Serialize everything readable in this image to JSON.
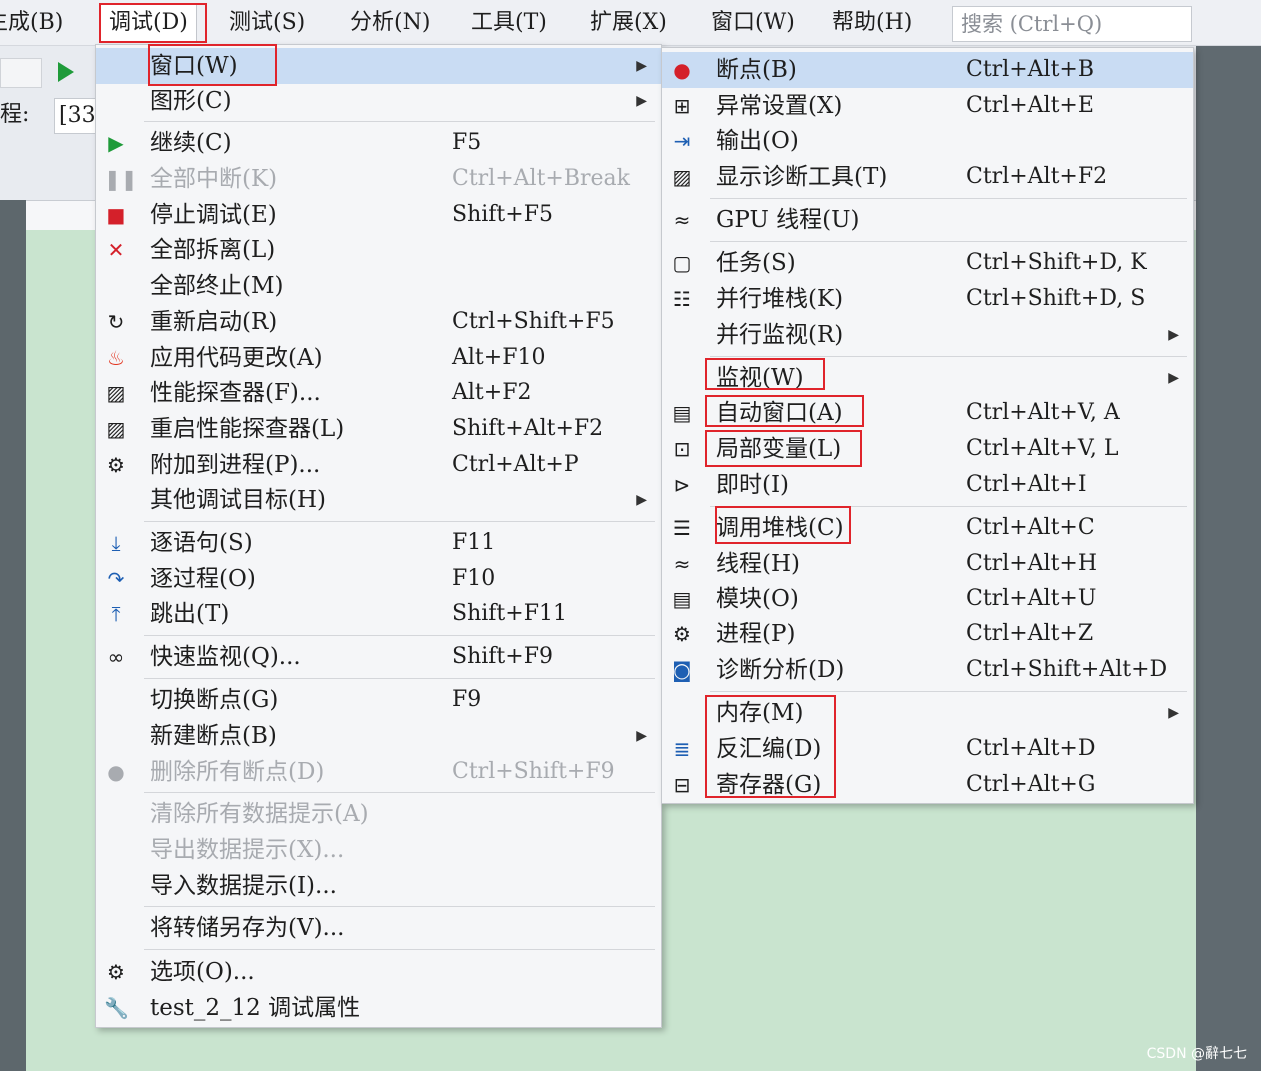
{
  "menubar": {
    "items": [
      {
        "label": "生成(B)"
      },
      {
        "label": "调试(D)"
      },
      {
        "label": "测试(S)"
      },
      {
        "label": "分析(N)"
      },
      {
        "label": "工具(T)"
      },
      {
        "label": "扩展(X)"
      },
      {
        "label": "窗口(W)"
      },
      {
        "label": "帮助(H)"
      }
    ],
    "search_placeholder": "搜索 (Ctrl+Q)"
  },
  "toolbar": {
    "process_label": "进程:",
    "process_value": "[33"
  },
  "debug_menu": {
    "items": [
      {
        "label": "窗口(W)",
        "shortcut": "",
        "icon": "",
        "submenu": true
      },
      {
        "label": "图形(C)",
        "shortcut": "",
        "icon": "",
        "submenu": true
      },
      {
        "label": "继续(C)",
        "shortcut": "F5",
        "icon": "play-icon"
      },
      {
        "label": "全部中断(K)",
        "shortcut": "Ctrl+Alt+Break",
        "icon": "pause-icon",
        "disabled": true
      },
      {
        "label": "停止调试(E)",
        "shortcut": "Shift+F5",
        "icon": "stop-icon"
      },
      {
        "label": "全部拆离(L)",
        "shortcut": "",
        "icon": "close-icon"
      },
      {
        "label": "全部终止(M)",
        "shortcut": "",
        "icon": ""
      },
      {
        "label": "重新启动(R)",
        "shortcut": "Ctrl+Shift+F5",
        "icon": "restart-icon"
      },
      {
        "label": "应用代码更改(A)",
        "shortcut": "Alt+F10",
        "icon": "flame-icon"
      },
      {
        "label": "性能探查器(F)...",
        "shortcut": "Alt+F2",
        "icon": "profiler-icon"
      },
      {
        "label": "重启性能探查器(L)",
        "shortcut": "Shift+Alt+F2",
        "icon": "profiler-icon"
      },
      {
        "label": "附加到进程(P)...",
        "shortcut": "Ctrl+Alt+P",
        "icon": "gears-icon"
      },
      {
        "label": "其他调试目标(H)",
        "shortcut": "",
        "icon": "",
        "submenu": true
      },
      {
        "label": "逐语句(S)",
        "shortcut": "F11",
        "icon": "step-into-icon"
      },
      {
        "label": "逐过程(O)",
        "shortcut": "F10",
        "icon": "step-over-icon"
      },
      {
        "label": "跳出(T)",
        "shortcut": "Shift+F11",
        "icon": "step-out-icon"
      },
      {
        "label": "快速监视(Q)...",
        "shortcut": "Shift+F9",
        "icon": "glasses-icon"
      },
      {
        "label": "切换断点(G)",
        "shortcut": "F9",
        "icon": ""
      },
      {
        "label": "新建断点(B)",
        "shortcut": "",
        "icon": "",
        "submenu": true
      },
      {
        "label": "删除所有断点(D)",
        "shortcut": "Ctrl+Shift+F9",
        "icon": "delete-breakpoints-icon",
        "disabled": true
      },
      {
        "label": "清除所有数据提示(A)",
        "shortcut": "",
        "icon": "",
        "disabled": true
      },
      {
        "label": "导出数据提示(X)...",
        "shortcut": "",
        "icon": "",
        "disabled": true
      },
      {
        "label": "导入数据提示(I)...",
        "shortcut": "",
        "icon": ""
      },
      {
        "label": "将转储另存为(V)...",
        "shortcut": "",
        "icon": ""
      },
      {
        "label": "选项(O)...",
        "shortcut": "",
        "icon": "gear-icon"
      },
      {
        "label": "test_2_12 调试属性",
        "shortcut": "",
        "icon": "wrench-icon"
      }
    ]
  },
  "window_submenu": {
    "items": [
      {
        "label": "断点(B)",
        "shortcut": "Ctrl+Alt+B",
        "icon": "breakpoint-icon"
      },
      {
        "label": "异常设置(X)",
        "shortcut": "Ctrl+Alt+E",
        "icon": "exception-icon"
      },
      {
        "label": "输出(O)",
        "shortcut": "",
        "icon": "output-icon"
      },
      {
        "label": "显示诊断工具(T)",
        "shortcut": "Ctrl+Alt+F2",
        "icon": "diagnostics-icon"
      },
      {
        "label": "GPU 线程(U)",
        "shortcut": "",
        "icon": "threads-icon"
      },
      {
        "label": "任务(S)",
        "shortcut": "Ctrl+Shift+D, K",
        "icon": "clipboard-icon"
      },
      {
        "label": "并行堆栈(K)",
        "shortcut": "Ctrl+Shift+D, S",
        "icon": "parallel-stacks-icon"
      },
      {
        "label": "并行监视(R)",
        "shortcut": "",
        "icon": "",
        "submenu": true
      },
      {
        "label": "监视(W)",
        "shortcut": "",
        "icon": "",
        "submenu": true
      },
      {
        "label": "自动窗口(A)",
        "shortcut": "Ctrl+Alt+V, A",
        "icon": "autos-icon"
      },
      {
        "label": "局部变量(L)",
        "shortcut": "Ctrl+Alt+V, L",
        "icon": "locals-icon"
      },
      {
        "label": "即时(I)",
        "shortcut": "Ctrl+Alt+I",
        "icon": "immediate-icon"
      },
      {
        "label": "调用堆栈(C)",
        "shortcut": "Ctrl+Alt+C",
        "icon": "call-stack-icon"
      },
      {
        "label": "线程(H)",
        "shortcut": "Ctrl+Alt+H",
        "icon": "threads-icon"
      },
      {
        "label": "模块(O)",
        "shortcut": "Ctrl+Alt+U",
        "icon": "modules-icon"
      },
      {
        "label": "进程(P)",
        "shortcut": "Ctrl+Alt+Z",
        "icon": "gears-icon"
      },
      {
        "label": "诊断分析(D)",
        "shortcut": "Ctrl+Shift+Alt+D",
        "icon": "analysis-icon"
      },
      {
        "label": "内存(M)",
        "shortcut": "",
        "icon": "",
        "submenu": true
      },
      {
        "label": "反汇编(D)",
        "shortcut": "Ctrl+Alt+D",
        "icon": "disassembly-icon"
      },
      {
        "label": "寄存器(G)",
        "shortcut": "Ctrl+Alt+G",
        "icon": "registers-icon"
      }
    ]
  },
  "watermark": "CSDN @辭七七",
  "colors": {
    "highlight": "#c9dcf3",
    "annotation_red": "#e0242b",
    "menu_bg": "#f5f6f8",
    "editor_bg": "#c9e4cf"
  }
}
